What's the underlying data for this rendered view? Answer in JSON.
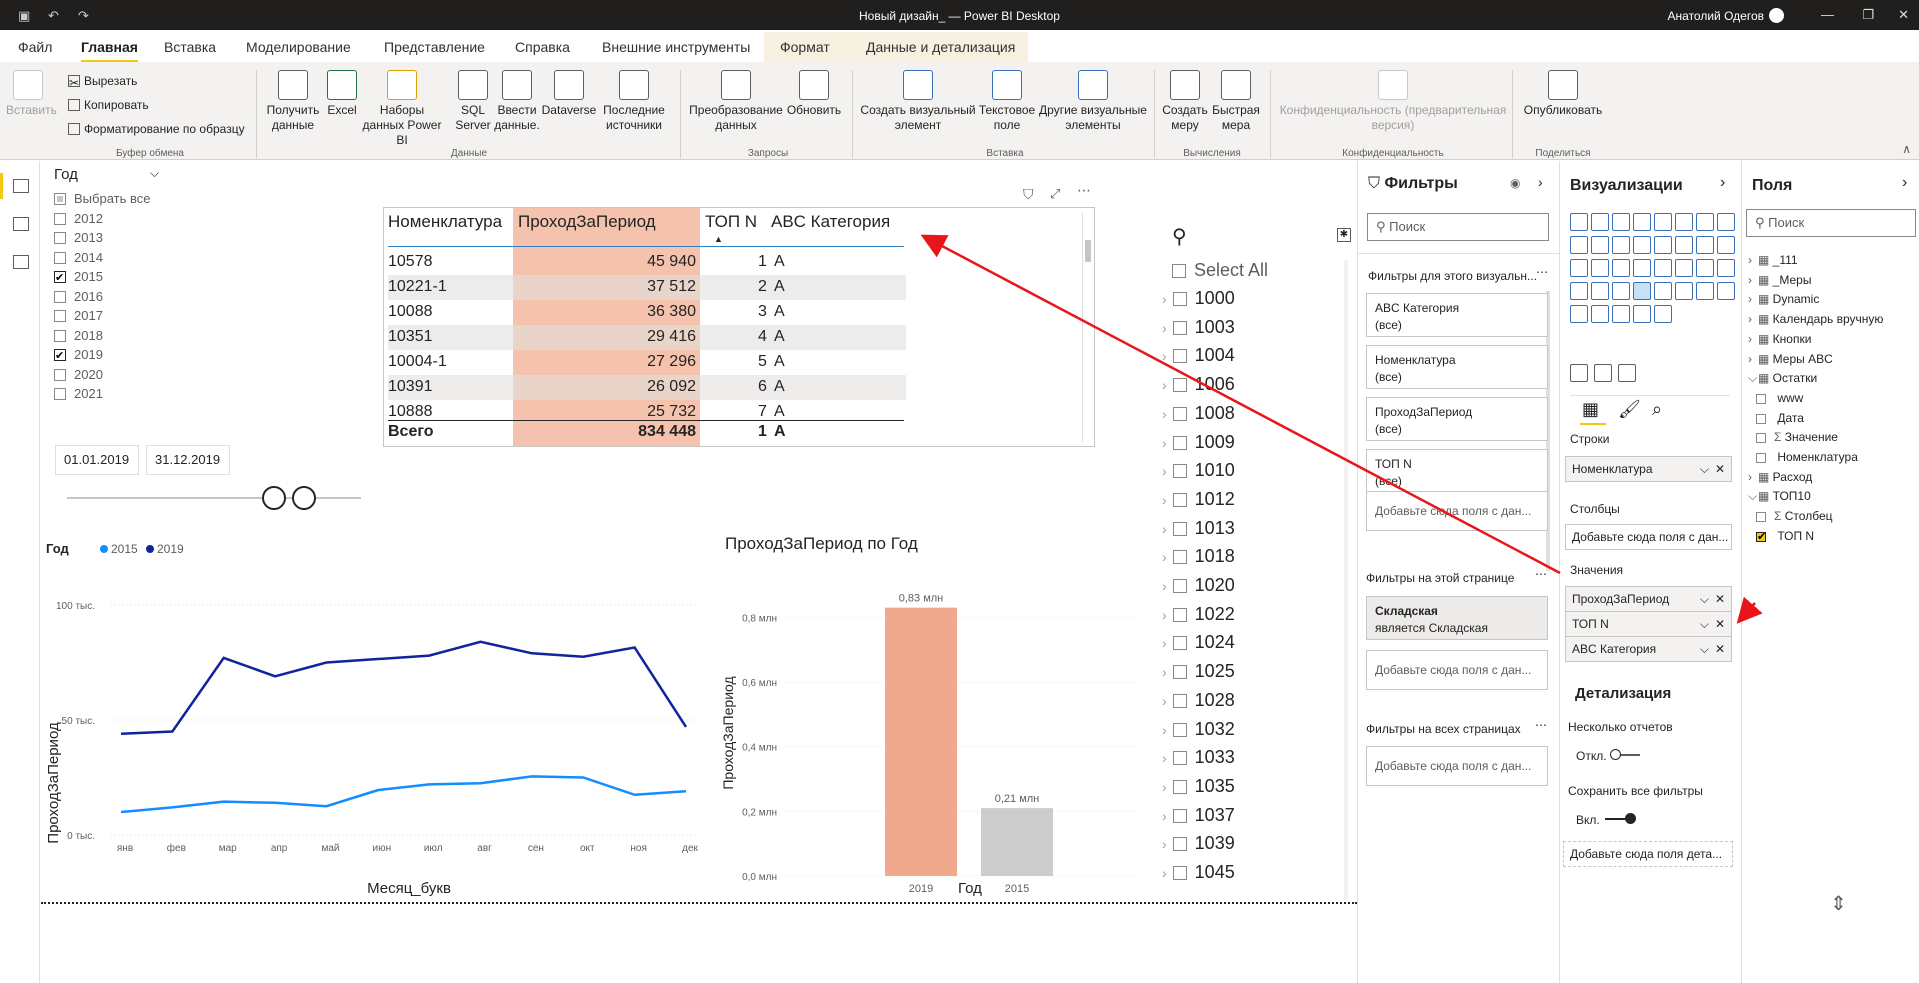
{
  "window": {
    "title": "Новый дизайн_ — Power BI Desktop",
    "user": "Анатолий Одегов"
  },
  "menu": {
    "tabs": [
      "Файл",
      "Главная",
      "Вставка",
      "Моделирование",
      "Представление",
      "Справка",
      "Внешние инструменты",
      "Формат",
      "Данные и детализация"
    ]
  },
  "ribbon": {
    "paste": "Вставить",
    "cut": "Вырезать",
    "copy": "Копировать",
    "format_painter": "Форматирование по образцу",
    "clipboard_group": "Буфер обмена",
    "get_data": "Получить данные",
    "excel": "Excel",
    "datasets": "Наборы данных Power BI",
    "sql": "SQL Server",
    "enter_data": "Ввести данные.",
    "dataverse": "Dataverse",
    "recent": "Последние источники",
    "data_group": "Данные",
    "transform": "Преобразование данных",
    "refresh": "Обновить",
    "queries_group": "Запросы",
    "new_visual": "Создать визуальный элемент",
    "textbox": "Текстовое поле",
    "more_visuals": "Другие визуальные элементы",
    "insert_group": "Вставка",
    "new_measure": "Создать меру",
    "quick_measure": "Быстрая мера",
    "calc_group": "Вычисления",
    "sensitivity": "Конфиденциальность (предварительная версия)",
    "sensitivity_group": "Конфиденциальность",
    "publish": "Опубликовать",
    "share_group": "Поделиться"
  },
  "year_slicer": {
    "header": "Год",
    "select_all": "Выбрать все",
    "items": [
      {
        "label": "2012",
        "checked": false
      },
      {
        "label": "2013",
        "checked": false
      },
      {
        "label": "2014",
        "checked": false
      },
      {
        "label": "2015",
        "checked": true
      },
      {
        "label": "2016",
        "checked": false
      },
      {
        "label": "2017",
        "checked": false
      },
      {
        "label": "2018",
        "checked": false
      },
      {
        "label": "2019",
        "checked": true
      },
      {
        "label": "2020",
        "checked": false
      },
      {
        "label": "2021",
        "checked": false
      }
    ]
  },
  "date_slicer": {
    "start": "01.01.2019",
    "end": "31.12.2019"
  },
  "table": {
    "headers": [
      "Номенклатура",
      "ПроходЗаПериод",
      "ТОП N",
      "ABC Категория"
    ],
    "rows": [
      [
        "10578",
        "45 940",
        "1",
        "A"
      ],
      [
        "10221-1",
        "37 512",
        "2",
        "A"
      ],
      [
        "10088",
        "36 380",
        "3",
        "A"
      ],
      [
        "10351",
        "29 416",
        "4",
        "A"
      ],
      [
        "10004-1",
        "27 296",
        "5",
        "A"
      ],
      [
        "10391",
        "26 092",
        "6",
        "A"
      ],
      [
        "10888",
        "25 732",
        "7",
        "A"
      ]
    ],
    "total": [
      "Всего",
      "834 448",
      "1",
      "A"
    ]
  },
  "big_slicer": {
    "select_all": "Select All",
    "items": [
      "1000",
      "1003",
      "1004",
      "1006",
      "1008",
      "1009",
      "1010",
      "1012",
      "1013",
      "1018",
      "1020",
      "1022",
      "1024",
      "1025",
      "1028",
      "1032",
      "1033",
      "1035",
      "1037",
      "1039",
      "1045"
    ]
  },
  "filters": {
    "title": "Фильтры",
    "search": "Поиск",
    "visual_section": "Фильтры для этого визуальн...",
    "cards": [
      {
        "name": "ABC Категория",
        "value": "(все)"
      },
      {
        "name": "Номенклатура",
        "value": "(все)"
      },
      {
        "name": "ПроходЗаПериод",
        "value": "(все)"
      },
      {
        "name": "ТОП N",
        "value": "(все)"
      }
    ],
    "add_here": "Добавьте сюда поля с дан...",
    "page_section": "Фильтры на этой странице",
    "page_card": {
      "name": "Складская",
      "value": "является Складская"
    },
    "all_section": "Фильтры на всех страницах"
  },
  "visualizations": {
    "title": "Визуализации",
    "rows_label": "Строки",
    "rows_field": "Номенклатура",
    "cols_label": "Столбцы",
    "cols_placeholder": "Добавьте сюда поля с дан...",
    "values_label": "Значения",
    "values": [
      "ПроходЗаПериод",
      "ТОП N",
      "ABC Категория"
    ],
    "drill_title": "Детализация",
    "cross_report": "Несколько отчетов",
    "cross_state": "Откл.",
    "keep_filters": "Сохранить все фильтры",
    "keep_state": "Вкл.",
    "drill_placeholder": "Добавьте сюда поля дета..."
  },
  "fields": {
    "title": "Поля",
    "search": "Поиск",
    "items": [
      {
        "label": "_111",
        "level": 0
      },
      {
        "label": "_Меры",
        "level": 0
      },
      {
        "label": "Dynamic",
        "level": 0
      },
      {
        "label": "Календарь вручную",
        "level": 0
      },
      {
        "label": "Кнопки",
        "level": 0
      },
      {
        "label": "Меры ABC",
        "level": 0
      },
      {
        "label": "Остатки",
        "level": 0
      },
      {
        "label": "www",
        "level": 1
      },
      {
        "label": "Дата",
        "level": 1
      },
      {
        "label": "Значение",
        "level": 1
      },
      {
        "label": "Номенклатура",
        "level": 1
      },
      {
        "label": "Расход",
        "level": 0
      },
      {
        "label": "ТОП10",
        "level": 0
      },
      {
        "label": "Столбец",
        "level": 1
      },
      {
        "label": "ТОП N",
        "level": 1
      }
    ]
  },
  "line_chart": {
    "legend_title": "Год",
    "ylabel": "ПроходЗаПериод",
    "xlabel": "Месяц_букв"
  },
  "bar_chart": {
    "title": "ПроходЗаПериод по Год",
    "ylabel": "ПроходЗаПериод",
    "xlabel": "Год"
  },
  "chart_data": [
    {
      "type": "line",
      "title": "",
      "xlabel": "Месяц_букв",
      "ylabel": "ПроходЗаПериод",
      "categories": [
        "янв",
        "фев",
        "мар",
        "апр",
        "май",
        "июн",
        "июл",
        "авг",
        "сен",
        "окт",
        "ноя",
        "дек"
      ],
      "ylim": [
        0,
        100000
      ],
      "yticks": [
        "0 тыс.",
        "50 тыс.",
        "100 тыс."
      ],
      "series": [
        {
          "name": "2015",
          "color": "#118dff",
          "values": [
            10000,
            12000,
            14500,
            14000,
            12500,
            19500,
            22000,
            22500,
            25500,
            25000,
            17500,
            19000
          ]
        },
        {
          "name": "2019",
          "color": "#12239e",
          "values": [
            44000,
            45000,
            77000,
            69000,
            75000,
            76500,
            78000,
            84000,
            79000,
            77500,
            81500,
            47000
          ]
        }
      ]
    },
    {
      "type": "bar",
      "title": "ПроходЗаПериод по Год",
      "xlabel": "Год",
      "ylabel": "ПроходЗаПериод",
      "categories": [
        "2019",
        "2015"
      ],
      "values": [
        0.83,
        0.21
      ],
      "data_labels": [
        "0,83 млн",
        "0,21 млн"
      ],
      "colors": [
        "#f0a98c",
        "#cccccc"
      ],
      "ylim": [
        0,
        0.9
      ],
      "yticks": [
        "0,0 млн",
        "0,2 млн",
        "0,4 млн",
        "0,6 млн",
        "0,8 млн"
      ]
    }
  ]
}
